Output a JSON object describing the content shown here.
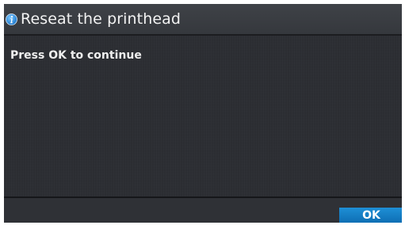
{
  "dialog": {
    "title": "Reseat the printhead",
    "title_icon": "info-icon",
    "message": "Press OK to continue"
  },
  "footer": {
    "ok_label": "OK"
  },
  "colors": {
    "accent": "#1a85cc",
    "background": "#2c2e33",
    "text": "#eeeeee"
  }
}
